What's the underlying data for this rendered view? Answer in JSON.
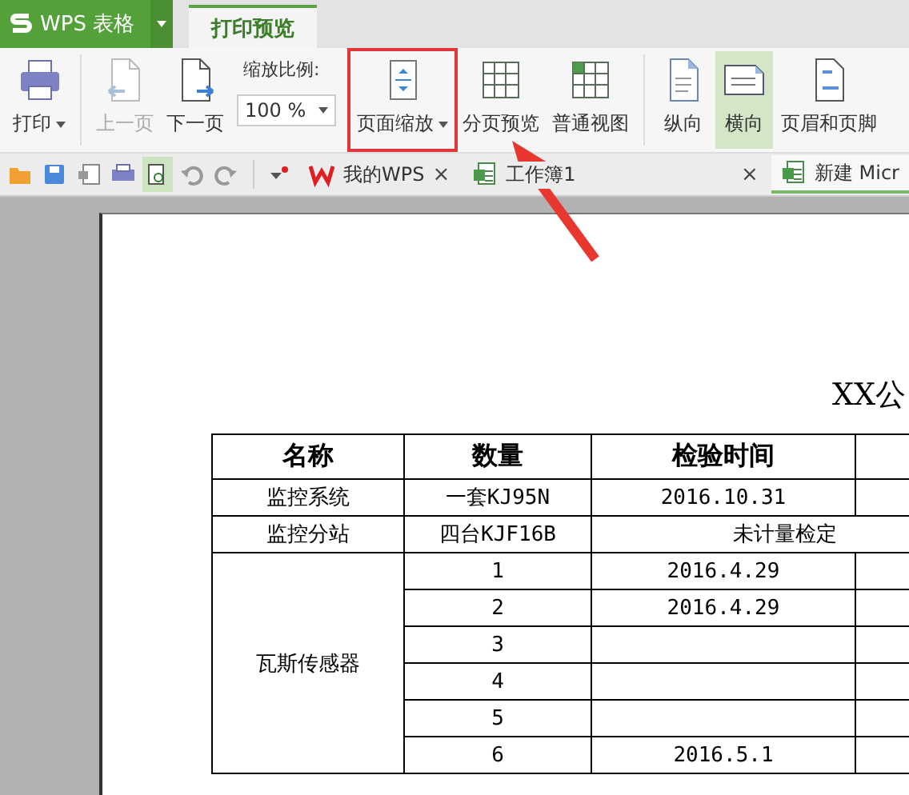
{
  "app_menu": {
    "label": "WPS 表格"
  },
  "tabs": [
    {
      "label": "打印预览",
      "selected": true
    }
  ],
  "ribbon": [
    {
      "kind": "button",
      "label": "打印",
      "caret": true,
      "disabled": false,
      "selected": false,
      "marked": false
    },
    {
      "kind": "separator"
    },
    {
      "kind": "button",
      "label": "上一页",
      "caret": false,
      "disabled": true,
      "selected": false,
      "marked": false
    },
    {
      "kind": "button",
      "label": "下一页",
      "caret": false,
      "disabled": false,
      "selected": false,
      "marked": false
    },
    {
      "kind": "zoom",
      "label": "缩放比例:",
      "value": "100 %"
    },
    {
      "kind": "button",
      "label": "页面缩放",
      "caret": true,
      "disabled": false,
      "selected": false,
      "marked": true
    },
    {
      "kind": "button",
      "label": "分页预览",
      "caret": false,
      "disabled": false,
      "selected": false,
      "marked": false
    },
    {
      "kind": "button",
      "label": "普通视图",
      "caret": false,
      "disabled": false,
      "selected": false,
      "marked": false
    },
    {
      "kind": "separator"
    },
    {
      "kind": "button",
      "label": "纵向",
      "caret": false,
      "disabled": false,
      "selected": false,
      "marked": false
    },
    {
      "kind": "button",
      "label": "横向",
      "caret": false,
      "disabled": false,
      "selected": true,
      "marked": false
    },
    {
      "kind": "button",
      "label": "页眉和页脚",
      "caret": false,
      "disabled": false,
      "selected": false,
      "marked": false
    }
  ],
  "quick_tools": [
    {
      "selected": false
    },
    {
      "selected": false
    },
    {
      "selected": false
    },
    {
      "selected": false
    },
    {
      "selected": true
    },
    {
      "selected": false
    },
    {
      "selected": false
    }
  ],
  "doc_tabs": [
    {
      "label": "我的WPS",
      "close": "×",
      "selected": false
    },
    {
      "label": "工作簿1",
      "close": "×",
      "selected": false
    },
    {
      "label": "新建 Micr",
      "selected": true
    }
  ],
  "document": {
    "title": "XX公",
    "columns": [
      "名称",
      "数量",
      "检验时间"
    ],
    "rows": [
      {
        "name": "监控系统",
        "quantity": "一套KJ95N",
        "date": "2016.10.31"
      },
      {
        "name": "监控分站",
        "quantity": "四台KJF16B",
        "note": "未计量检定"
      },
      {
        "name": "瓦斯传感器",
        "children": [
          {
            "quantity": "1",
            "date": "2016.4.29"
          },
          {
            "quantity": "2",
            "date": "2016.4.29"
          },
          {
            "quantity": "3"
          },
          {
            "quantity": "4"
          },
          {
            "quantity": "5"
          },
          {
            "quantity": "6",
            "date": "2016.5.1"
          }
        ]
      }
    ]
  }
}
